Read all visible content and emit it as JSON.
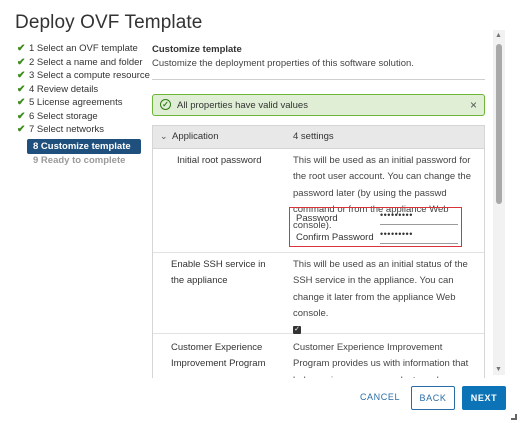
{
  "dialog": {
    "title": "Deploy OVF Template"
  },
  "steps": [
    {
      "label": "1 Select an OVF template",
      "state": "done"
    },
    {
      "label": "2 Select a name and folder",
      "state": "done"
    },
    {
      "label": "3 Select a compute resource",
      "state": "done"
    },
    {
      "label": "4 Review details",
      "state": "done"
    },
    {
      "label": "5 License agreements",
      "state": "done"
    },
    {
      "label": "6 Select storage",
      "state": "done"
    },
    {
      "label": "7 Select networks",
      "state": "done"
    },
    {
      "label": "8 Customize template",
      "state": "active"
    },
    {
      "label": "9 Ready to complete",
      "state": "future"
    }
  ],
  "content": {
    "title": "Customize template",
    "description": "Customize the deployment properties of this software solution.",
    "alert": "All properties have valid values",
    "group": {
      "name": "Application",
      "count": "4 settings"
    },
    "rows": [
      {
        "label": "Initial root password",
        "value": "This will be used as an initial password for the root user account. You can change the password later (by using the passwd command or from the appliance Web console).",
        "password_label": "Password",
        "password_value": "•••••••••",
        "confirm_label": "Confirm Password",
        "confirm_value": "•••••••••"
      },
      {
        "label": "Enable SSH service in the appliance",
        "value": "This will be used as an initial status of the SSH service in the appliance. You can change it later from the appliance Web console."
      },
      {
        "label": "Customer Experience Improvement Program",
        "value": "Customer Experience Improvement Program provides us with information that helps us improve our products and services."
      }
    ]
  },
  "buttons": {
    "cancel": "CANCEL",
    "back": "BACK",
    "next": "NEXT"
  },
  "colors": {
    "accent": "#0b73b6",
    "active_step": "#1f4f7d",
    "success": "#3c8b1c",
    "alert_bg": "#dfeed5",
    "highlight": "#d9343a"
  }
}
